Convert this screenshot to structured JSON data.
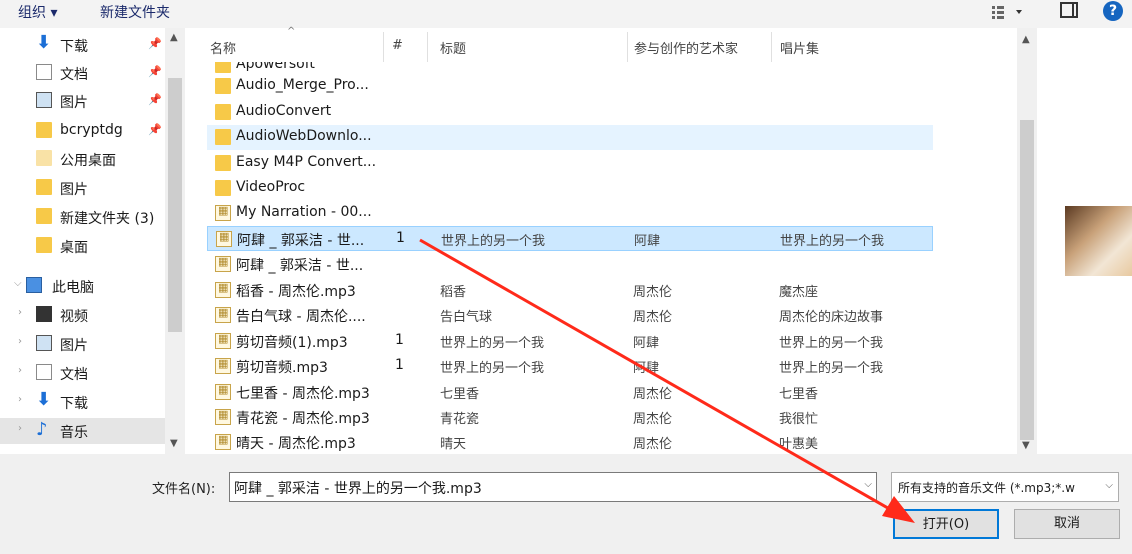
{
  "toolbar": {
    "organize": "组织 ▾",
    "new_folder": "新建文件夹"
  },
  "sidebar": {
    "items": [
      {
        "label": "下载",
        "icon": "download-icon",
        "pinned": true
      },
      {
        "label": "文档",
        "icon": "document-icon",
        "pinned": true
      },
      {
        "label": "图片",
        "icon": "picture-icon",
        "pinned": true
      },
      {
        "label": "bcryptdg",
        "icon": "folder-icon",
        "pinned": true
      },
      {
        "label": "公用桌面",
        "icon": "folder-icon",
        "pinned": false
      },
      {
        "label": "图片",
        "icon": "folder-icon",
        "pinned": false
      },
      {
        "label": "新建文件夹 (3)",
        "icon": "folder-icon",
        "pinned": false
      },
      {
        "label": "桌面",
        "icon": "folder-icon",
        "pinned": false
      },
      {
        "label": "此电脑",
        "icon": "computer-icon",
        "pinned": false
      },
      {
        "label": "视频",
        "icon": "video-icon",
        "pinned": false
      },
      {
        "label": "图片",
        "icon": "picture-icon",
        "pinned": false
      },
      {
        "label": "文档",
        "icon": "document-icon",
        "pinned": false
      },
      {
        "label": "下载",
        "icon": "download-icon",
        "pinned": false
      },
      {
        "label": "音乐",
        "icon": "music-icon",
        "pinned": false,
        "selected": true
      }
    ]
  },
  "columns": {
    "name": "名称",
    "number": "#",
    "title": "标题",
    "artist": "参与创作的艺术家",
    "album": "唱片集"
  },
  "files": [
    {
      "name": "Apowersoft",
      "type": "folder",
      "number": "",
      "title": "",
      "artist": "",
      "album": ""
    },
    {
      "name": "Audio_Merge_Pro...",
      "type": "folder",
      "number": "",
      "title": "",
      "artist": "",
      "album": ""
    },
    {
      "name": "AudioConvert",
      "type": "folder",
      "number": "",
      "title": "",
      "artist": "",
      "album": ""
    },
    {
      "name": "AudioWebDownlo...",
      "type": "folder",
      "number": "",
      "title": "",
      "artist": "",
      "album": ""
    },
    {
      "name": "Easy M4P Convert...",
      "type": "folder",
      "number": "",
      "title": "",
      "artist": "",
      "album": ""
    },
    {
      "name": "VideoProc",
      "type": "folder",
      "number": "",
      "title": "",
      "artist": "",
      "album": ""
    },
    {
      "name": "My Narration - 00...",
      "type": "mp3",
      "number": "",
      "title": "",
      "artist": "",
      "album": ""
    },
    {
      "name": "阿肆 _ 郭采洁 - 世...",
      "type": "mp3",
      "number": "1",
      "title": "世界上的另一个我",
      "artist": "阿肆",
      "album": "世界上的另一个我"
    },
    {
      "name": "阿肆 _ 郭采洁 - 世...",
      "type": "mp3",
      "number": "",
      "title": "",
      "artist": "",
      "album": ""
    },
    {
      "name": "稻香 - 周杰伦.mp3",
      "type": "mp3",
      "number": "",
      "title": "稻香",
      "artist": "周杰伦",
      "album": "魔杰座"
    },
    {
      "name": "告白气球 - 周杰伦....",
      "type": "mp3",
      "number": "",
      "title": "告白气球",
      "artist": "周杰伦",
      "album": "周杰伦的床边故事"
    },
    {
      "name": "剪切音频(1).mp3",
      "type": "mp3",
      "number": "1",
      "title": "世界上的另一个我",
      "artist": "阿肆",
      "album": "世界上的另一个我"
    },
    {
      "name": "剪切音频.mp3",
      "type": "mp3",
      "number": "1",
      "title": "世界上的另一个我",
      "artist": "阿肆",
      "album": "世界上的另一个我"
    },
    {
      "name": "七里香 - 周杰伦.mp3",
      "type": "mp3",
      "number": "",
      "title": "七里香",
      "artist": "周杰伦",
      "album": "七里香"
    },
    {
      "name": "青花瓷 - 周杰伦.mp3",
      "type": "mp3",
      "number": "",
      "title": "青花瓷",
      "artist": "周杰伦",
      "album": "我很忙"
    },
    {
      "name": "晴天 - 周杰伦.mp3",
      "type": "mp3",
      "number": "",
      "title": "晴天",
      "artist": "周杰伦",
      "album": "叶惠美"
    }
  ],
  "bottom": {
    "filename_label": "文件名(N):",
    "filename_value": "阿肆 _ 郭采洁 - 世界上的另一个我.mp3",
    "filetype_value": "所有支持的音乐文件 (*.mp3;*.w",
    "open_label": "打开(O)",
    "cancel_label": "取消"
  },
  "colors": {
    "selected_row": "#cce8ff",
    "hover_row": "#e5f3ff",
    "annotation": "#ff2a1a",
    "accent": "#0078d7"
  }
}
